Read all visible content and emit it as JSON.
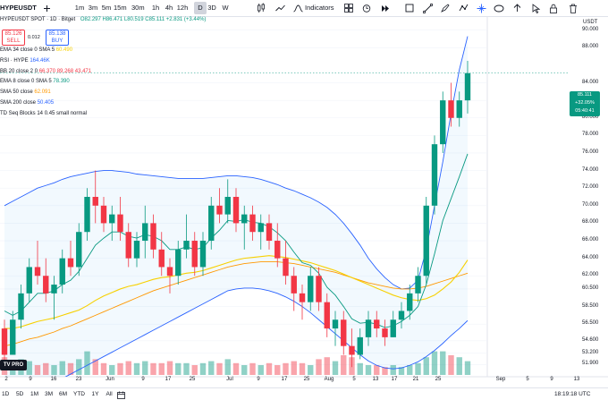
{
  "toolbar": {
    "symbol": "HYPEUSDT",
    "intervals": [
      {
        "label": "1m",
        "active": false
      },
      {
        "label": "3m",
        "active": false
      },
      {
        "label": "5m",
        "active": false
      },
      {
        "label": "15m",
        "active": false
      },
      {
        "label": "30m",
        "active": false
      },
      {
        "label": "1h",
        "active": false
      },
      {
        "label": "4h",
        "active": false
      },
      {
        "label": "12h",
        "active": false
      },
      {
        "label": "D",
        "active": true
      },
      {
        "label": "3D",
        "active": false
      },
      {
        "label": "W",
        "active": false
      }
    ],
    "indicators_label": "Indicators"
  },
  "header": {
    "title": "HYPEUSDT SPOT · 1D · Bitget",
    "o": "O82.297",
    "h": "H86.471",
    "l": "L80.519",
    "c": "C85.111",
    "chg": "+2.831 (+3.44%)"
  },
  "trade": {
    "sell_price": "85.126",
    "sell_label": "SELL",
    "buy_price": "85.138",
    "buy_label": "BUY",
    "spread": "0.012"
  },
  "legends": [
    {
      "text": "EMA 34 close 0 SMA 5",
      "value": "60.490",
      "color": "#f7d000"
    },
    {
      "text": "RSI · HYPE",
      "value": "164.46K",
      "color": "#2962ff"
    },
    {
      "text": "BB 20 close 2 0",
      "value": "66.370  89.268  43.471",
      "color": "#f23645"
    },
    {
      "text": "EMA 8 close 0 SMA 5",
      "value": "78.390",
      "color": "#089981"
    },
    {
      "text": "SMA 50 close",
      "value": "62.091",
      "color": "#ff9800"
    },
    {
      "text": "SMA 200 close",
      "value": "50.405",
      "color": "#2962ff"
    },
    {
      "text": "TD Seq Blocks 14 0.45 small normal",
      "value": "",
      "color": "#787b86"
    }
  ],
  "price_axis": {
    "unit": "USDT",
    "ticks": [
      "90.000",
      "88.000",
      "84.000",
      "82.000",
      "80.000",
      "78.000",
      "76.000",
      "74.000",
      "72.000",
      "70.000",
      "68.000",
      "66.000",
      "64.000",
      "62.000",
      "60.500",
      "58.500",
      "56.500",
      "54.600",
      "53.200",
      "51.900"
    ],
    "current": {
      "price": "85.111",
      "pct": "+32.05%",
      "time": "05:40:41"
    }
  },
  "time_axis": [
    "2",
    "9",
    "16",
    "23",
    "Jun",
    "9",
    "17",
    "25",
    "Jul",
    "9",
    "17",
    "25",
    "Aug",
    "5",
    "13",
    "17",
    "21",
    "25",
    "Sep",
    "5",
    "9",
    "13"
  ],
  "bottom": {
    "ranges": [
      "1D",
      "5D",
      "1M",
      "3M",
      "6M",
      "YTD",
      "1Y",
      "All"
    ],
    "time": "18:19:18 UTC",
    "logo": "TV PRO"
  },
  "colors": {
    "up": "#089981",
    "down": "#f23645",
    "bb": "#2962ff",
    "ema8": "#089981",
    "ema34": "#f7d000",
    "sma50": "#ff9800",
    "grid": "#f0f3fa"
  },
  "chart_data": {
    "type": "candlestick",
    "ylim": [
      50.5,
      91.5
    ],
    "candles": [
      [
        56,
        57,
        52,
        53
      ],
      [
        53,
        58,
        53,
        57
      ],
      [
        57,
        61,
        56,
        60
      ],
      [
        60,
        64,
        59,
        63
      ],
      [
        63,
        66,
        61,
        62
      ],
      [
        62,
        64,
        59,
        60
      ],
      [
        60,
        62,
        57,
        61
      ],
      [
        61,
        65,
        60,
        64
      ],
      [
        64,
        66,
        62,
        63
      ],
      [
        63,
        68,
        62,
        67
      ],
      [
        67,
        72,
        66,
        71
      ],
      [
        71,
        74,
        68,
        70
      ],
      [
        70,
        71,
        67,
        68
      ],
      [
        68,
        70,
        66,
        69
      ],
      [
        69,
        71,
        66,
        67
      ],
      [
        67,
        68,
        63,
        64
      ],
      [
        64,
        67,
        63,
        66
      ],
      [
        66,
        70,
        64,
        68
      ],
      [
        68,
        69,
        64,
        65
      ],
      [
        65,
        67,
        62,
        63
      ],
      [
        63,
        64,
        60,
        62
      ],
      [
        62,
        66,
        61,
        65
      ],
      [
        65,
        69,
        64,
        66
      ],
      [
        66,
        67,
        62,
        63
      ],
      [
        63,
        67,
        62,
        66
      ],
      [
        66,
        71,
        65,
        70
      ],
      [
        70,
        72,
        68,
        69
      ],
      [
        69,
        73,
        68,
        71
      ],
      [
        71,
        72,
        67,
        68
      ],
      [
        68,
        70,
        65,
        69
      ],
      [
        69,
        70,
        66,
        67
      ],
      [
        67,
        69,
        65,
        68
      ],
      [
        68,
        69,
        65,
        66
      ],
      [
        66,
        68,
        63,
        64
      ],
      [
        64,
        66,
        61,
        62
      ],
      [
        62,
        63,
        58,
        60
      ],
      [
        60,
        61,
        57,
        59
      ],
      [
        59,
        63,
        58,
        62
      ],
      [
        62,
        63,
        58,
        59
      ],
      [
        59,
        60,
        55,
        56
      ],
      [
        56,
        58,
        54,
        57
      ],
      [
        57,
        58,
        53,
        54
      ],
      [
        54,
        56,
        51.6,
        53
      ],
      [
        53,
        56,
        52.5,
        55
      ],
      [
        55,
        58,
        54,
        57
      ],
      [
        57,
        58,
        55,
        56
      ],
      [
        56,
        57,
        54,
        55
      ],
      [
        55,
        58,
        55,
        57
      ],
      [
        57,
        59,
        56,
        58
      ],
      [
        58,
        61,
        57,
        60
      ],
      [
        60,
        63,
        59,
        62
      ],
      [
        62,
        71,
        61,
        70
      ],
      [
        70,
        78,
        69,
        77
      ],
      [
        77,
        83,
        76,
        82
      ],
      [
        82,
        84,
        79,
        80
      ],
      [
        80,
        83,
        79,
        82
      ],
      [
        82,
        86.5,
        80.5,
        85.1
      ]
    ],
    "ema8": [
      58,
      57.5,
      58,
      59,
      60,
      60,
      60.3,
      61,
      61.5,
      62.5,
      64,
      65.5,
      66.3,
      67,
      67,
      66.5,
      66.3,
      66.7,
      66.5,
      66,
      65,
      65,
      65.3,
      65,
      65.2,
      66.3,
      67.2,
      68.3,
      68.2,
      68.4,
      68.1,
      68,
      67.6,
      66.9,
      66,
      64.7,
      63.5,
      63.2,
      62.3,
      60.7,
      59.8,
      58.5,
      57.1,
      56.6,
      56.7,
      56.5,
      56.1,
      56.3,
      56.8,
      57.5,
      58.5,
      61,
      64.5,
      68.3,
      70.8,
      73.3,
      75.9
    ],
    "ema34": [
      56,
      56,
      56.2,
      56.5,
      56.8,
      57,
      57.2,
      57.5,
      57.8,
      58.1,
      58.6,
      59.2,
      59.7,
      60.1,
      60.5,
      60.8,
      61,
      61.3,
      61.6,
      61.8,
      61.9,
      62.1,
      62.3,
      62.4,
      62.6,
      62.9,
      63.2,
      63.5,
      63.8,
      64,
      64.1,
      64.2,
      64.3,
      64.2,
      64.1,
      63.9,
      63.7,
      63.5,
      63.2,
      62.9,
      62.6,
      62.2,
      61.8,
      61.4,
      61,
      60.6,
      60.2,
      59.8,
      59.5,
      59.3,
      59.2,
      59.4,
      59.8,
      60.5,
      61.3,
      62.4,
      63.8
    ],
    "sma50": [
      54,
      54.2,
      54.5,
      54.8,
      55,
      55.3,
      55.6,
      56,
      56.3,
      56.7,
      57.1,
      57.5,
      57.9,
      58.3,
      58.7,
      59.1,
      59.5,
      59.9,
      60.3,
      60.6,
      60.9,
      61.2,
      61.5,
      61.8,
      62.1,
      62.4,
      62.7,
      63,
      63.2,
      63.4,
      63.5,
      63.6,
      63.6,
      63.6,
      63.5,
      63.4,
      63.2,
      63,
      62.8,
      62.6,
      62.4,
      62.1,
      61.8,
      61.5,
      61.2,
      61,
      60.8,
      60.6,
      60.5,
      60.5,
      60.6,
      60.8,
      61.1,
      61.4,
      61.7,
      62,
      62.3
    ],
    "bb_upper": [
      70,
      70.5,
      71,
      71.5,
      72,
      72.3,
      72.6,
      73,
      73.3,
      73.5,
      73.7,
      73.9,
      74,
      74,
      73.9,
      73.8,
      73.6,
      73.5,
      73.4,
      73.3,
      73.2,
      73.1,
      73.1,
      73.1,
      73.1,
      73.2,
      73.3,
      73.4,
      73.4,
      73.3,
      73.2,
      73,
      72.7,
      72.4,
      72,
      71.7,
      71.3,
      70.9,
      70.4,
      69.8,
      69,
      68,
      66.8,
      65.5,
      64,
      62.8,
      61.8,
      61,
      60.5,
      60.6,
      61.5,
      65,
      70,
      75,
      80.5,
      85.5,
      89.3
    ],
    "bb_lower": [
      47,
      47.3,
      47.8,
      48.3,
      48.8,
      49.3,
      49.8,
      50.3,
      50.8,
      51.3,
      51.8,
      52.3,
      52.8,
      53.3,
      53.8,
      54.3,
      54.8,
      55.3,
      55.8,
      56.3,
      56.8,
      57.3,
      57.8,
      58.3,
      58.8,
      59.3,
      59.8,
      60.3,
      60.5,
      60.6,
      60.6,
      60.5,
      60.3,
      60,
      59.6,
      59.1,
      58.5,
      57.8,
      57,
      56.2,
      55.4,
      54.6,
      53.8,
      53,
      52.3,
      51.8,
      51.5,
      51.4,
      51.5,
      51.8,
      52.2,
      52.8,
      53.5,
      54.3,
      55.2,
      56,
      56.9
    ],
    "volumes": [
      9,
      6,
      8,
      7,
      5,
      6,
      5,
      7,
      6,
      8,
      12,
      8,
      6,
      5,
      6,
      7,
      6,
      7,
      6,
      6,
      7,
      6,
      6,
      5,
      6,
      7,
      6,
      8,
      6,
      5,
      6,
      5,
      6,
      5,
      6,
      7,
      6,
      5,
      8,
      9,
      7,
      10,
      9,
      6,
      5,
      5,
      4,
      5,
      4,
      5,
      6,
      9,
      12,
      12,
      10,
      9,
      7
    ]
  }
}
